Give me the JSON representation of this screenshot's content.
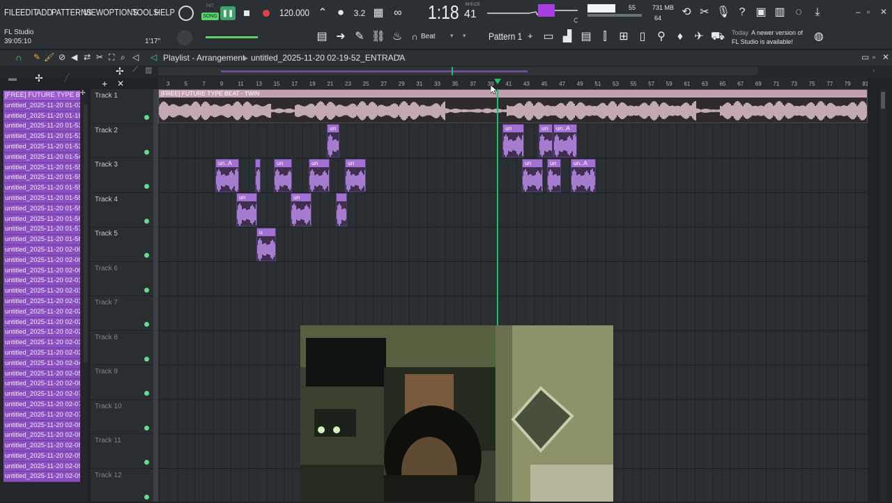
{
  "menu": {
    "items": [
      "FILE",
      "EDIT",
      "ADD",
      "PATTERNS",
      "VIEW",
      "OPTIONS",
      "TOOLS",
      "HELP"
    ]
  },
  "transport": {
    "pat_label": "PAT",
    "song_label": "SONG",
    "tempo": "120.000",
    "time": "1:18",
    "time_small": "41",
    "time_unit": "M:S:CS",
    "master_vol": "55",
    "mem_mb": "731 MB",
    "cpu": "64"
  },
  "app": {
    "name": "FL Studio",
    "elapsed": "39:05:10",
    "hint_time": "1'17\""
  },
  "toolbar": {
    "snap_label": "Beat",
    "pattern_label": "Pattern 1",
    "plus": "+"
  },
  "news": {
    "today": "Today",
    "line1": "A newer version of",
    "line2": "FL Studio is available!"
  },
  "playlist": {
    "title": "Playlist - Arrangement",
    "project": "untitled_2025-11-20 02-19-52_ENTRADA",
    "track1_clip": "[FREE] FUTURE TYPE BEAT - TWIN"
  },
  "browser": {
    "items": [
      "[FREE] FUTURE TYPE BE...",
      "untitled_2025-11-20 01-03...",
      "untitled_2025-11-20 01-18...",
      "untitled_2025-11-20 01-53...",
      "untitled_2025-11-20 01-53...",
      "untitled_2025-11-20 01-53...",
      "untitled_2025-11-20 01-54...",
      "untitled_2025-11-20 01-55...",
      "untitled_2025-11-20 01-55...",
      "untitled_2025-11-20 01-55...",
      "untitled_2025-11-20 01-55...",
      "untitled_2025-11-20 01-55...",
      "untitled_2025-11-20 01-56...",
      "untitled_2025-11-20 01-57...",
      "untitled_2025-11-20 01-58...",
      "untitled_2025-11-20 02-00...",
      "untitled_2025-11-20 02-00...",
      "untitled_2025-11-20 02-00...",
      "untitled_2025-11-20 02-01...",
      "untitled_2025-11-20 02-01...",
      "untitled_2025-11-20 02-01...",
      "untitled_2025-11-20 02-02...",
      "untitled_2025-11-20 02-02...",
      "untitled_2025-11-20 02-02...",
      "untitled_2025-11-20 02-03...",
      "untitled_2025-11-20 02-03...",
      "untitled_2025-11-20 02-04...",
      "untitled_2025-11-20 02-05...",
      "untitled_2025-11-20 02-06...",
      "untitled_2025-11-20 02-07...",
      "untitled_2025-11-20 02-07...",
      "untitled_2025-11-20 02-07...",
      "untitled_2025-11-20 02-08...",
      "untitled_2025-11-20 02-08...",
      "untitled_2025-11-20 02-08...",
      "untitled_2025-11-20 02-09...",
      "untitled_2025-11-20 02-09...",
      "untitled_2025-11-20 02-09..."
    ]
  },
  "tracks": [
    "Track 1",
    "Track 2",
    "Track 3",
    "Track 4",
    "Track 5",
    "Track 6",
    "Track 7",
    "Track 8",
    "Track 9",
    "Track 10",
    "Track 11",
    "Track 12"
  ],
  "ruler": [
    "3",
    "5",
    "7",
    "9",
    "11",
    "13",
    "15",
    "17",
    "19",
    "21",
    "23",
    "25",
    "27",
    "29",
    "31",
    "33",
    "35",
    "37",
    "39",
    "41",
    "43",
    "45",
    "47",
    "49",
    "51",
    "53",
    "55",
    "57",
    "59",
    "61",
    "63",
    "65",
    "67",
    "69",
    "71",
    "73",
    "75",
    "77",
    "79",
    "81"
  ],
  "clips": {
    "un": "un",
    "unA": "un..A",
    "u": "u"
  },
  "colors": {
    "clip_head": "#a26fd3",
    "browser_item": "#8b4ec0",
    "playhead": "#19c36b",
    "track_dot": "#5be08a"
  }
}
